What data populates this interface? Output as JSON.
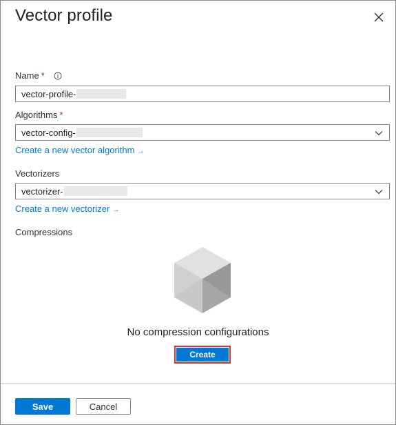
{
  "panel": {
    "title": "Vector profile",
    "close_icon": "close-icon"
  },
  "name_field": {
    "label": "Name",
    "required_marker": "*",
    "info_icon": "info-icon",
    "value": "vector-profile-"
  },
  "algorithms_field": {
    "label": "Algorithms",
    "required_marker": "*",
    "value": "vector-config-",
    "dropdown_icon": "chevron-down-icon"
  },
  "create_algorithm_link": {
    "label": "Create a new vector algorithm",
    "arrow": "→"
  },
  "vectorizers_field": {
    "label": "Vectorizers",
    "value": "vectorizer-",
    "dropdown_icon": "chevron-down-icon"
  },
  "create_vectorizer_link": {
    "label": "Create a new vectorizer",
    "arrow": "→"
  },
  "compressions": {
    "label": "Compressions",
    "empty_icon": "cube-icon",
    "empty_message": "No compression configurations",
    "create_label": "Create",
    "highlight_color": "#e0303a"
  },
  "footer": {
    "save_label": "Save",
    "cancel_label": "Cancel"
  },
  "colors": {
    "accent": "#0078d4",
    "required": "#a4262c"
  }
}
